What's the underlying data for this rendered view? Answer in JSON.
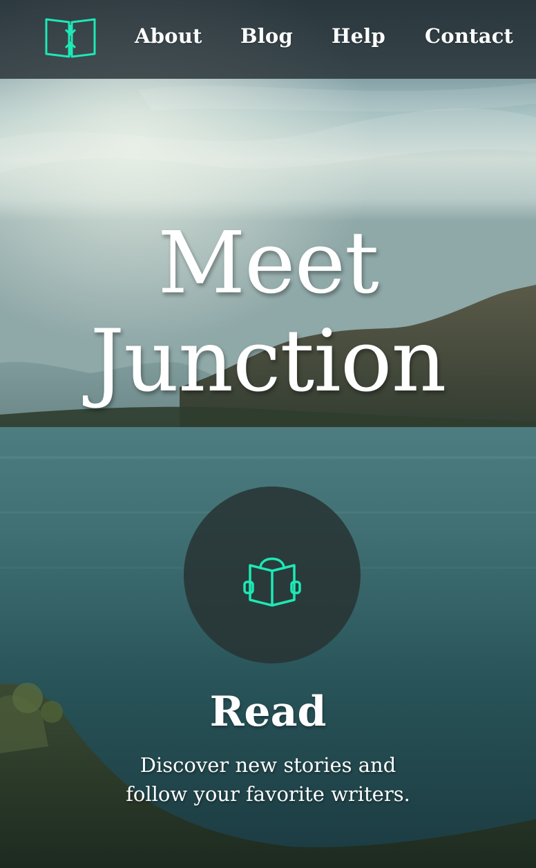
{
  "header": {
    "logo_icon": "book-arrows-logo-icon",
    "nav": [
      {
        "label": "About"
      },
      {
        "label": "Blog"
      },
      {
        "label": "Help"
      },
      {
        "label": "Contact"
      }
    ]
  },
  "hero": {
    "title_line1": "Meet",
    "title_line2": "Junction"
  },
  "feature": {
    "icon": "reader-book-icon",
    "title": "Read",
    "desc_line1": "Discover new stories and",
    "desc_line2": "follow your favorite writers."
  },
  "colors": {
    "accent": "#1de9b6",
    "header_bg": "#263034",
    "text": "#ffffff"
  }
}
